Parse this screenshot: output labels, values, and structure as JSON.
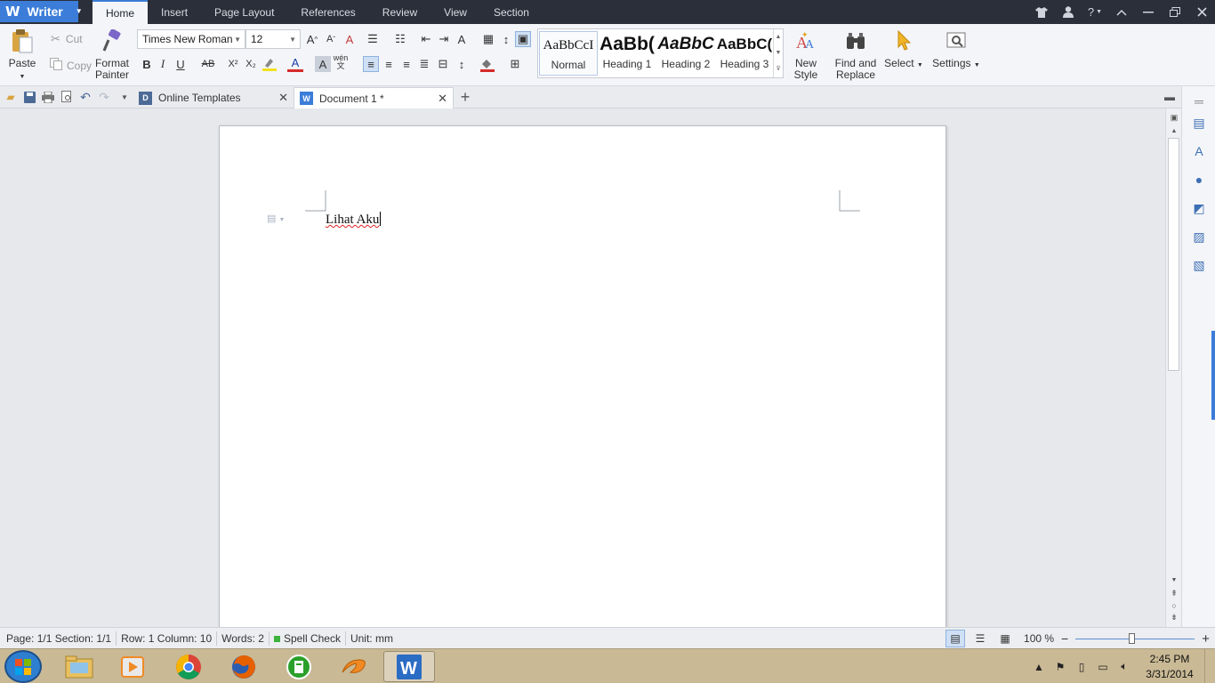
{
  "app": {
    "name": "Writer",
    "logo": "W"
  },
  "menu": {
    "tabs": [
      "Home",
      "Insert",
      "Page Layout",
      "References",
      "Review",
      "View",
      "Section"
    ],
    "active": "Home"
  },
  "window_controls": {
    "skin": "shirt-icon",
    "account": "user-icon",
    "help": "?"
  },
  "ribbon": {
    "paste": "Paste",
    "cut": "Cut",
    "copy": "Copy",
    "format_painter_1": "Format",
    "format_painter_2": "Painter",
    "font_name": "Times New Roman",
    "font_size": "12",
    "bold": "B",
    "italic": "I",
    "underline": "U",
    "strike": "AB",
    "superscript": "X²",
    "subscript": "X₂",
    "font_color": "A",
    "char_shade": "A",
    "phonetic": "wén",
    "styles": [
      {
        "preview": "AaBbCcI",
        "name": "Normal"
      },
      {
        "preview": "AaBb(",
        "name": "Heading 1"
      },
      {
        "preview": "AaBbC",
        "name": "Heading 2"
      },
      {
        "preview": "AaBbC(",
        "name": "Heading 3"
      }
    ],
    "new_style_1": "New",
    "new_style_2": "Style",
    "find_1": "Find and",
    "find_2": "Replace",
    "select": "Select",
    "settings": "Settings"
  },
  "tabs": [
    {
      "label": "Online Templates",
      "active": false
    },
    {
      "label": "Document 1 *",
      "active": true
    }
  ],
  "document": {
    "text": "Lihat Aku"
  },
  "status": {
    "page": "Page: 1/1",
    "section": "Section: 1/1",
    "rowcol": "Row: 1 Column: 10",
    "words": "Words: 2",
    "spell": "Spell Check",
    "unit": "Unit: mm",
    "zoom": "100 %",
    "zoom_fraction": 0.47
  },
  "taskbar": {
    "apps": [
      "explorer-icon",
      "media-player-icon",
      "chrome-icon",
      "firefox-icon",
      "green-app-icon",
      "orange-app-icon",
      "wps-writer-icon"
    ],
    "time": "2:45 PM",
    "date": "3/31/2014"
  },
  "colors": {
    "accent": "#3b7dd8",
    "menubar": "#2b2f3a",
    "taskbar": "#c9b995",
    "spell_error": "#e02020"
  }
}
